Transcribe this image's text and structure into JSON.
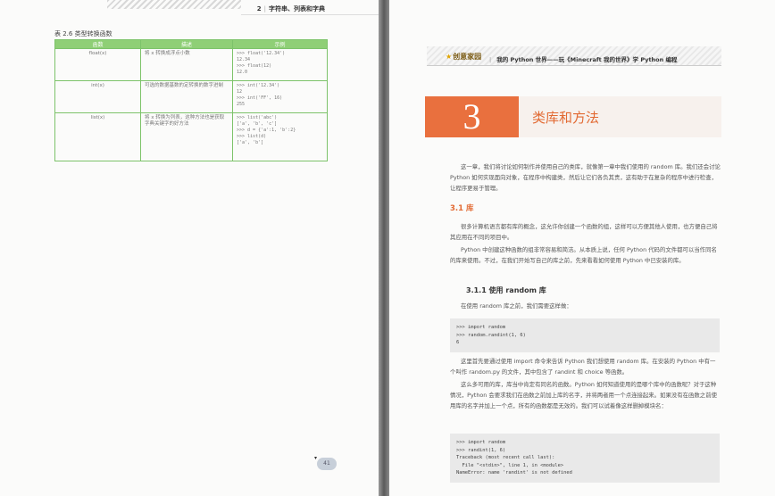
{
  "left_page": {
    "header": {
      "chapter_no": "2",
      "chapter_title": "字符串、列表和字典"
    },
    "table_caption": "表 2.6   类型转换函数",
    "table_headers": [
      "函数",
      "描述",
      "示例"
    ],
    "table_rows": [
      {
        "fn": "float(x)",
        "desc": "将 x 转换成浮点小数",
        "example": ">>> float('12.34')\n12.34\n>>> float(12)\n12.0"
      },
      {
        "fn": "int(x)",
        "desc": "可选的数据基数的定转换的数字进制",
        "example": ">>> int('12.34')\n12\n>>> int('FF', 16)\n255"
      },
      {
        "fn": "list(x)",
        "desc": "将 x 转换为列表，这种方法也是获取字典关键字的好方法",
        "example": ">>> list('abc')\n['a', 'b', 'c']\n>>> d = {'a':1, 'b':2}\n>>> list(d)\n['a', 'b']"
      }
    ],
    "page_number": "41"
  },
  "right_page": {
    "header": {
      "logo": "创意家园",
      "title": "我的 Python 世界——玩《Minecraft 我的世界》学 Python 编程"
    },
    "chapter": {
      "number": "3",
      "title": "类库和方法"
    },
    "intro": "这一章，我们将讨论如何制作并使用自己的类库，就像第一章中我们使用的 random 库。我们还会讨论 Python 如何实现面向对象，在程序中构建类，然后让它们各负其责，这有助于在复杂的程序中进行检查，让程序更易于管理。",
    "section_31": "3.1   库",
    "p1": "很多计算机语言都有库的概念，这允许你创建一个函数的组，这样可以方便其他人使用，也方便自己将其应用在不同的项目中。",
    "p2": "Python 中创建这种函数的组非常容易和简洁。从本质上说，任何 Python 代码的文件都可以当作同名的库来使用。不过，在我们开始写自己的库之前，先来看看如何使用 Python 中已安装的库。",
    "section_311": "3.1.1   使用 random 库",
    "p3": "在使用 random 库之前，我们需要这样做：",
    "code1": ">>> import random\n>>> random.randint(1, 6)\n6",
    "p4": "这里首先要通过使用 import 命令来告诉 Python 我们想使用 random 库。在安装的 Python 中有一个叫作 random.py 的文件，其中包含了 randint 和 choice 等函数。",
    "p5": "这么多可用的库，库当中肯定有同名的函数。Python 如何知道使用的是哪个库中的函数呢？对于这种情况，Python 会要求我们在函数之前加上库的名字，并将两者用一个点连接起来。如果没有在函数之前使用库的名字并加上一个点，所有的函数都是无效的。我们可以试着像这样删掉模块名：",
    "code2": ">>> import random\n>>> randint(1, 6)\nTraceback (most recent call last):\n  File \"<stdin>\", line 1, in <module>\nNameError: name 'randint' is not defined"
  }
}
